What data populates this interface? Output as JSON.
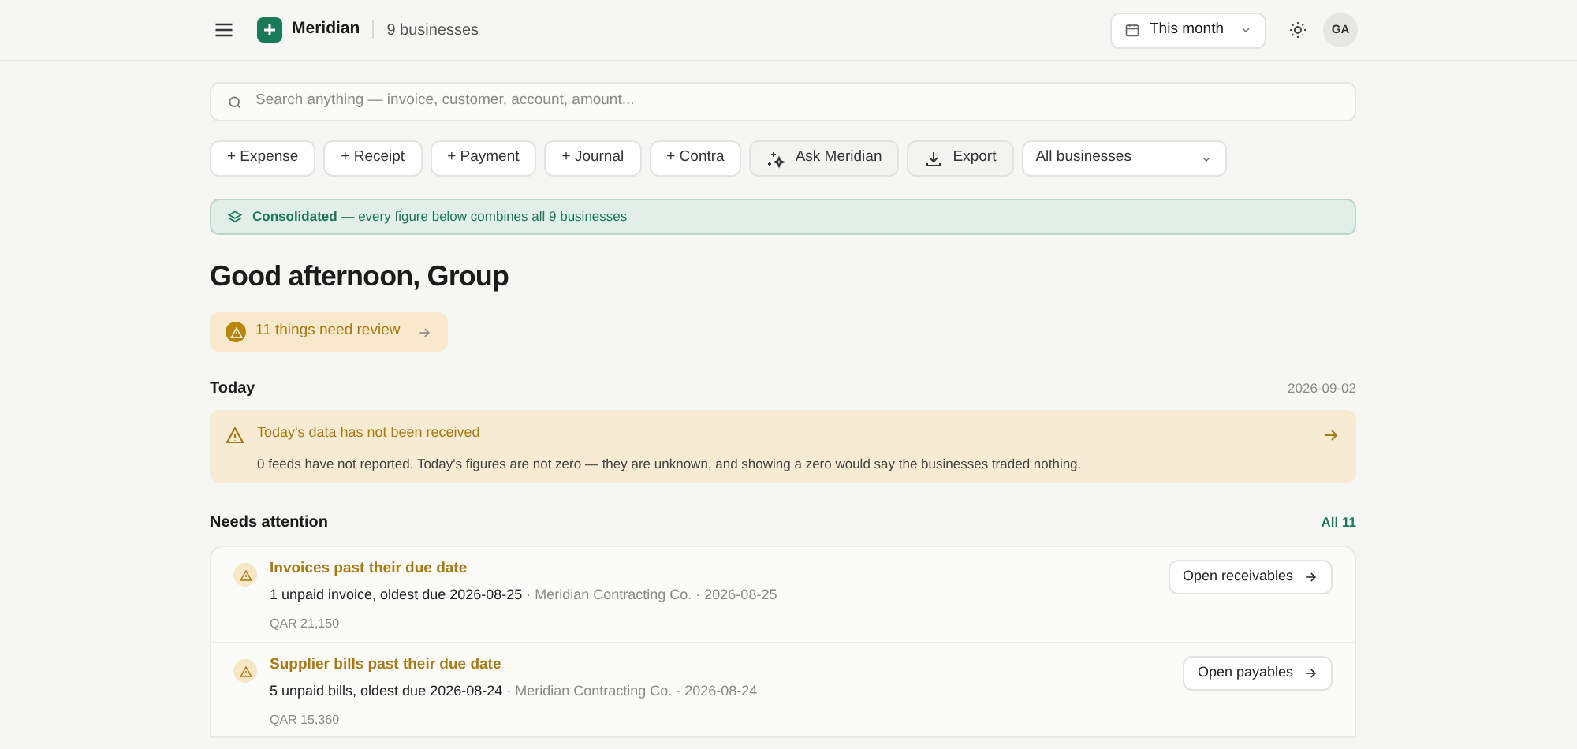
{
  "header": {
    "brand": "Meridian",
    "businesses": "9 businesses",
    "period": "This month",
    "avatar": "GA"
  },
  "search": {
    "placeholder": "Search anything — invoice, customer, account, amount..."
  },
  "actions": [
    {
      "kind": "add",
      "label": "+ Expense"
    },
    {
      "kind": "add",
      "label": "+ Receipt"
    },
    {
      "kind": "add",
      "label": "+ Payment"
    },
    {
      "kind": "add",
      "label": "+ Journal"
    },
    {
      "kind": "add",
      "label": "+ Contra"
    },
    {
      "kind": "ask",
      "label": "Ask Meridian"
    },
    {
      "kind": "export",
      "label": "Export"
    }
  ],
  "business_select": {
    "value": "All businesses"
  },
  "banner": {
    "text": "**Consolidated** — every figure below combines all 9 businesses"
  },
  "greeting": "Good afternoon, Group",
  "review": {
    "label": "11 things need review"
  },
  "today": {
    "title": "Today",
    "date": "2026-09-02"
  },
  "alert": {
    "title": "Today's data has not been received",
    "body": "0 feeds have not reported. Today's figures are not zero — they are unknown, and showing a zero would say the businesses traded nothing."
  },
  "attention": {
    "title": "Needs attention",
    "link": "All 11",
    "items": [
      {
        "title": "Invoices past their due date",
        "summary": "1 unpaid invoice, oldest due 2026-08-25",
        "meta": "· Meridian Contracting Co. · 2026-08-25",
        "amount": "QAR 21,150",
        "button": "Open receivables"
      },
      {
        "title": "Supplier bills past their due date",
        "summary": "5 unpaid bills, oldest due 2026-08-24",
        "meta": "· Meridian Contracting Co. · 2026-08-24",
        "amount": "QAR 15,360",
        "button": "Open payables"
      }
    ]
  }
}
